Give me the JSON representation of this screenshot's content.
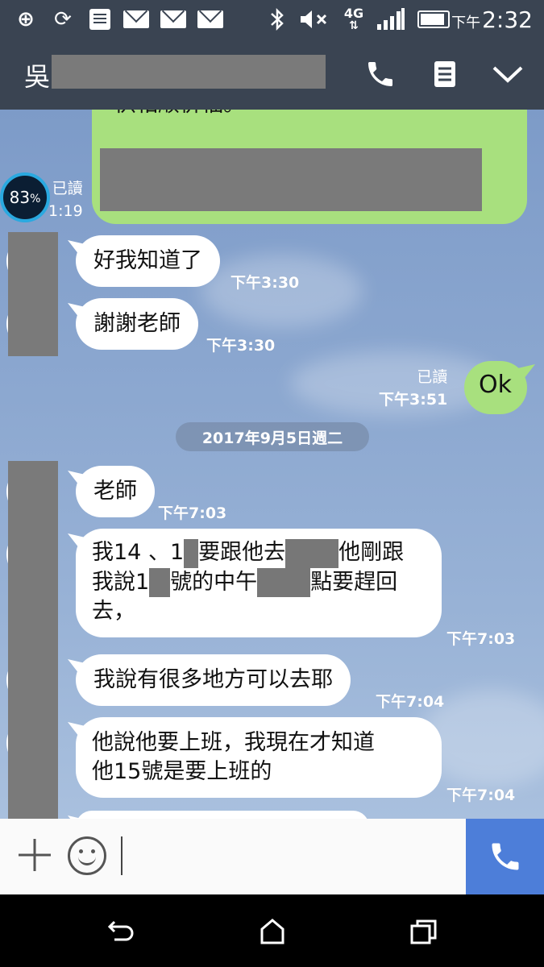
{
  "status_bar": {
    "time_prefix": "下午",
    "time": "2:32",
    "network": "4G",
    "icons": [
      "add-icon",
      "sync-icon",
      "document-icon",
      "mail-icon",
      "mail-icon",
      "mail-icon",
      "bluetooth-icon",
      "mute-icon",
      "network-4g-icon",
      "signal-icon",
      "battery-icon"
    ]
  },
  "header": {
    "title": "吳",
    "icons": [
      "phone-icon",
      "notes-icon",
      "chevron-down-icon"
    ]
  },
  "overlay": {
    "gauge": "83",
    "gauge_unit": "%"
  },
  "chat": {
    "top_message": {
      "cut_text": "供相顺併福。",
      "read": "已讀",
      "time": "1:19"
    },
    "messages": [
      {
        "side": "in",
        "text": "好我知道了",
        "time": "下午3:30"
      },
      {
        "side": "in",
        "text": "謝謝老師",
        "time": "下午3:30"
      },
      {
        "side": "out",
        "text": "Ok",
        "read": "已讀",
        "time": "下午3:51"
      }
    ],
    "date_divider": "2017年9月5日週二",
    "messages_after": [
      {
        "side": "in",
        "text": "老師",
        "time": "下午7:03"
      },
      {
        "side": "in",
        "line1_a": "我14 、1",
        "line1_b": "要跟他去",
        "line1_c": "他剛跟",
        "line2_a": "我說1",
        "line2_b": "號的中午",
        "line2_c": "點要趕回",
        "line3": "去，",
        "time": "下午7:03"
      },
      {
        "side": "in",
        "text": "我說有很多地方可以去耶",
        "time": "下午7:04"
      },
      {
        "side": "in",
        "line1": "他說他要上班，我現在才知道",
        "line2": "他15號是要上班的",
        "time": "下午7:04"
      }
    ]
  },
  "input_bar": {
    "icons": [
      "plus-icon",
      "emoji-icon",
      "call-icon"
    ]
  },
  "nav_bar": {
    "icons": [
      "back-icon",
      "home-icon",
      "recents-icon"
    ]
  }
}
